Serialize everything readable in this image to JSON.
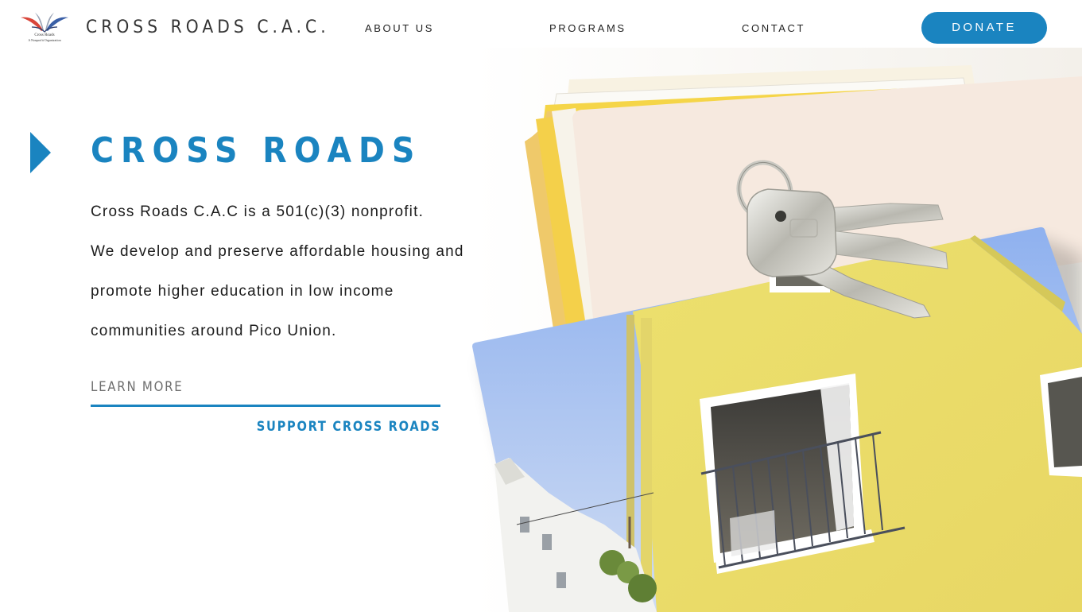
{
  "header": {
    "logo_line1": "Cross Roads",
    "logo_line2": "A Nonprofit Organization",
    "brand_name": "CROSS ROADS C.A.C.",
    "nav": [
      {
        "label": "ABOUT US"
      },
      {
        "label": "PROGRAMS"
      },
      {
        "label": "CONTACT"
      }
    ],
    "donate_label": "DONATE"
  },
  "hero": {
    "title": "CROSS ROADS",
    "lines": [
      "Cross Roads C.A.C is a 501(c)(3) nonprofit.",
      "We develop and preserve affordable housing and",
      "promote higher education in low income",
      "communities around Pico Union."
    ],
    "learn_more": "LEARN MORE",
    "support": "SUPPORT CROSS ROADS"
  },
  "colors": {
    "accent": "#1a84c0",
    "text": "#1c1c1c",
    "muted": "#6e6e6e",
    "folder_yellow": "#f5d548",
    "house_yellow": "#efdf6e",
    "sky_blue": "#9dbcef"
  },
  "icons": {
    "play": "play-triangle-icon",
    "logo": "open-book-wings-logo"
  }
}
